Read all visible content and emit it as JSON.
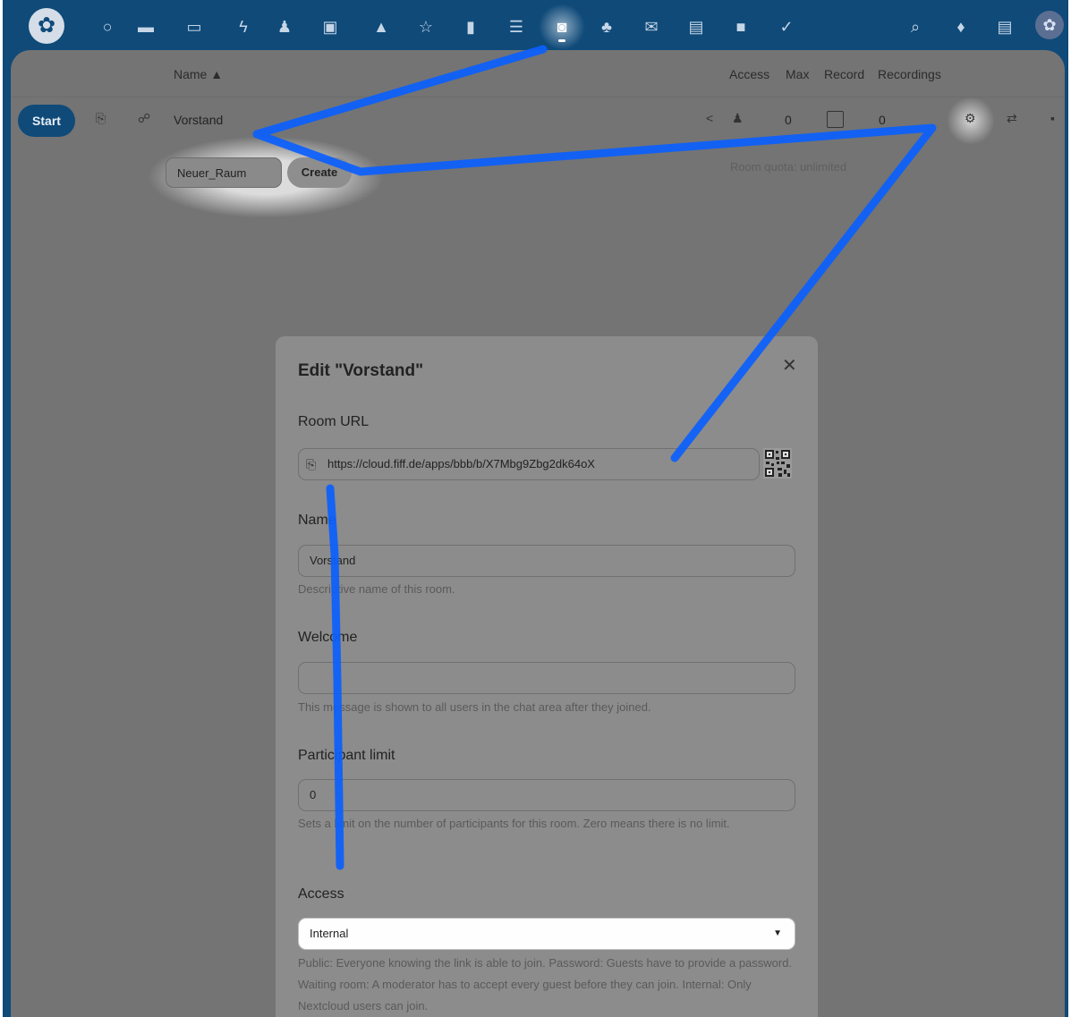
{
  "nav": {
    "logo_icon": "app-logo-icon",
    "apps": [
      {
        "icon": "dashboard-icon",
        "glyph": "○"
      },
      {
        "icon": "files-icon",
        "glyph": "▬"
      },
      {
        "icon": "photos-icon",
        "glyph": "▭"
      },
      {
        "icon": "activity-icon",
        "glyph": "ϟ"
      },
      {
        "icon": "contacts-icon",
        "glyph": "♟"
      },
      {
        "icon": "calendar-icon",
        "glyph": "▣"
      },
      {
        "icon": "deck-icon",
        "glyph": "▲"
      },
      {
        "icon": "bookmarks-icon",
        "glyph": "☆"
      },
      {
        "icon": "analytics-icon",
        "glyph": "▮"
      },
      {
        "icon": "tasks-icon",
        "glyph": "☰"
      },
      {
        "icon": "bbb-icon",
        "glyph": "◙",
        "active": true
      },
      {
        "icon": "circles-icon",
        "glyph": "♣"
      },
      {
        "icon": "mail-icon",
        "glyph": "✉"
      },
      {
        "icon": "notes-icon",
        "glyph": "▤"
      },
      {
        "icon": "video-icon",
        "glyph": "■"
      },
      {
        "icon": "checkmark-icon",
        "glyph": "✓"
      }
    ],
    "right": [
      {
        "icon": "search-icon",
        "glyph": "⌕"
      },
      {
        "icon": "notifications-icon",
        "glyph": "♦"
      },
      {
        "icon": "contacts-menu-icon",
        "glyph": "▤"
      }
    ],
    "avatar_glyph": "✿"
  },
  "table": {
    "headers": {
      "name": "Name ▲",
      "access": "Access",
      "max": "Max",
      "record": "Record",
      "recordings": "Recordings"
    },
    "room": {
      "start_label": "Start",
      "name": "Vorstand",
      "max": "0",
      "recordings": "0"
    },
    "quota": "Room quota: unlimited",
    "new_room_value": "Neuer_Raum",
    "create_label": "Create"
  },
  "modal": {
    "title": "Edit \"Vorstand\"",
    "room_url_label": "Room URL",
    "room_url": "https://cloud.fiff.de/apps/bbb/b/X7Mbg9Zbg2dk64oX",
    "name_label": "Name",
    "name_value": "Vorstand",
    "name_help": "Descriptive name of this room.",
    "welcome_label": "Welcome",
    "welcome_value": "",
    "welcome_help": "This message is shown to all users in the chat area after they joined.",
    "limit_label": "Participant limit",
    "limit_value": "0",
    "limit_help": "Sets a limit on the number of participants for this room. Zero means there is no limit.",
    "access_label": "Access",
    "access_value": "Internal",
    "access_help": "Public: Everyone knowing the link is able to join. Password: Guests have to provide a password. Waiting room: A moderator has to accept every guest before they can join. Internal: Only Nextcloud users can join."
  },
  "colors": {
    "header": "#0f4a79",
    "dimmed": "#747474",
    "annotation": "#0b5ffd"
  }
}
